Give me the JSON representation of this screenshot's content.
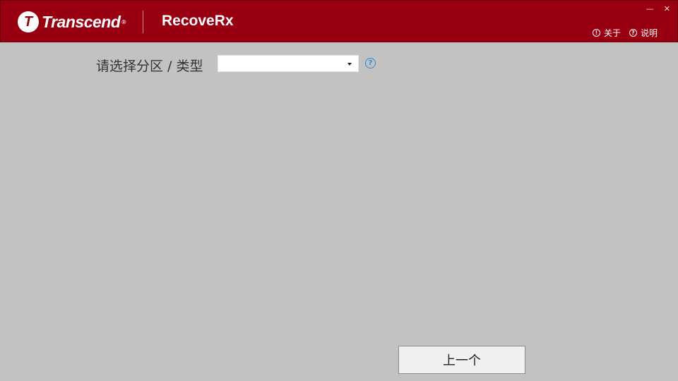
{
  "header": {
    "brand": "Transcend",
    "brand_mark": "T",
    "brand_reg": "®",
    "app_name": "RecoveRx",
    "links": [
      {
        "label": "关于",
        "icon": "info-icon",
        "glyph": "!"
      },
      {
        "label": "说明",
        "icon": "help-icon",
        "glyph": "?"
      }
    ],
    "window_controls": {
      "minimize": "—",
      "close": "✕"
    },
    "colors": {
      "header_bg": "#980012",
      "body_bg": "#c2c2c2",
      "accent": "#2f86d6"
    }
  },
  "main": {
    "prompt": "请选择分区 / 类型",
    "dropdown_value": "",
    "help_glyph": "?"
  },
  "footer": {
    "back_label": "上一个"
  }
}
